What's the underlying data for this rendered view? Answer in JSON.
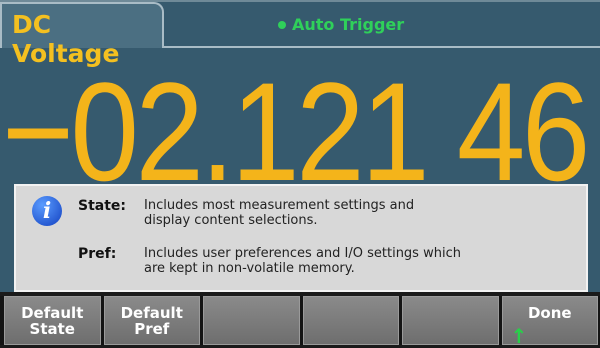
{
  "header": {
    "mode_label": "DC Voltage",
    "trigger_label": "Auto Trigger"
  },
  "reading": {
    "value": "−02.121 46"
  },
  "help": {
    "icon": "info-icon",
    "rows": [
      {
        "key": "State:",
        "text_line1": "Includes most measurement settings and",
        "text_line2": "display content selections."
      },
      {
        "key": "Pref:",
        "text_line1": "Includes user preferences and I/O settings which",
        "text_line2": "are kept in non-volatile memory."
      }
    ]
  },
  "softkeys": [
    {
      "line1": "Default",
      "line2": "State"
    },
    {
      "line1": "Default",
      "line2": "Pref"
    },
    {
      "line1": "",
      "line2": ""
    },
    {
      "line1": "",
      "line2": ""
    },
    {
      "line1": "",
      "line2": ""
    },
    {
      "line1": "Done",
      "line2": "",
      "icon": "up-arrow-icon"
    }
  ],
  "colors": {
    "mode_accent": "#f4c020",
    "trigger_green": "#2fd05a",
    "reading_amber": "#f4b41a",
    "screen_bg": "#365a6e"
  }
}
